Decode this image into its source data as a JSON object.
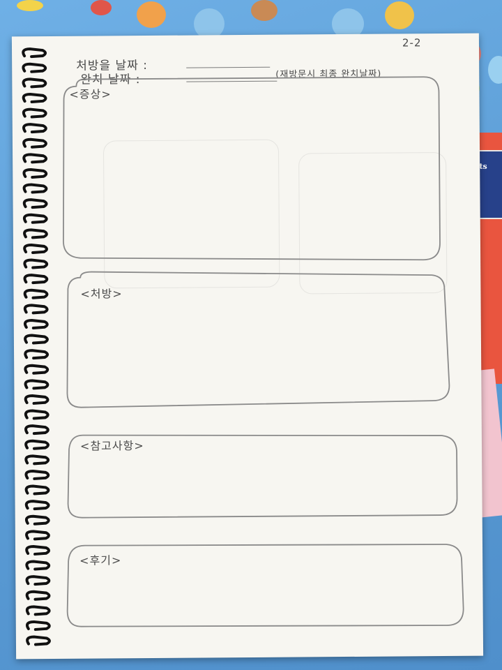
{
  "page": {
    "page_number": "2-2"
  },
  "header": {
    "prescription_date_label": "처방을 날짜 :",
    "completion_date_label": "완치 날짜 :",
    "completion_note": "(재방문시 최종 완치날짜)"
  },
  "sections": [
    {
      "label": "<증상>"
    },
    {
      "label": "<처방>"
    },
    {
      "label": "<참고사항>"
    },
    {
      "label": "<후기>"
    }
  ],
  "colors": {
    "paper": "#f7f6f1",
    "pencil": "#4a4a4a",
    "tablecloth": "#5d9fd6"
  }
}
